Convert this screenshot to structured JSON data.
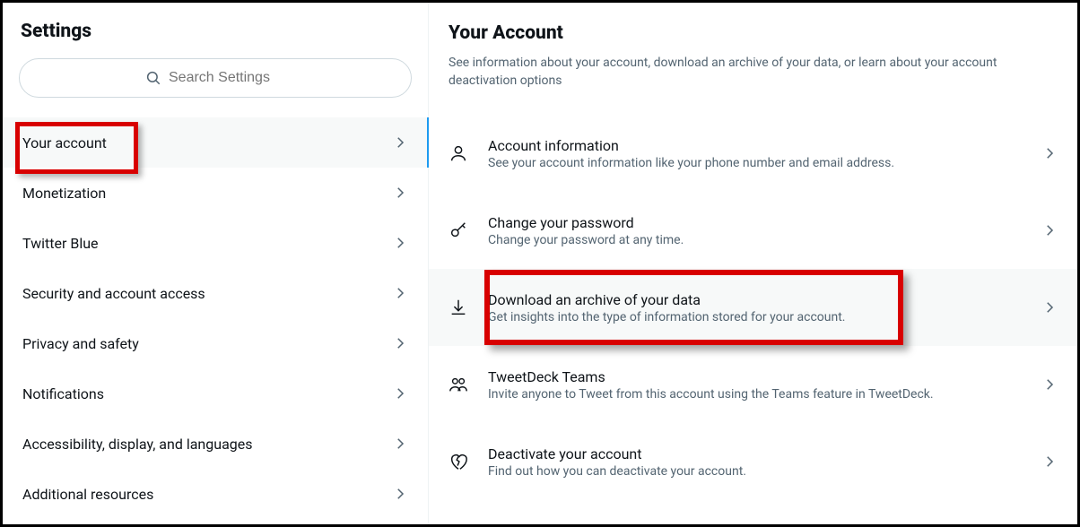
{
  "sidebar": {
    "title": "Settings",
    "search_placeholder": "Search Settings",
    "items": [
      {
        "label": "Your account"
      },
      {
        "label": "Monetization"
      },
      {
        "label": "Twitter Blue"
      },
      {
        "label": "Security and account access"
      },
      {
        "label": "Privacy and safety"
      },
      {
        "label": "Notifications"
      },
      {
        "label": "Accessibility, display, and languages"
      },
      {
        "label": "Additional resources"
      }
    ]
  },
  "main": {
    "title": "Your Account",
    "description": "See information about your account, download an archive of your data, or learn about your account deactivation options",
    "options": [
      {
        "title": "Account information",
        "sub": "See your account information like your phone number and email address."
      },
      {
        "title": "Change your password",
        "sub": "Change your password at any time."
      },
      {
        "title": "Download an archive of your data",
        "sub": "Get insights into the type of information stored for your account."
      },
      {
        "title": "TweetDeck Teams",
        "sub": "Invite anyone to Tweet from this account using the Teams feature in TweetDeck."
      },
      {
        "title": "Deactivate your account",
        "sub": "Find out how you can deactivate your account."
      }
    ]
  }
}
